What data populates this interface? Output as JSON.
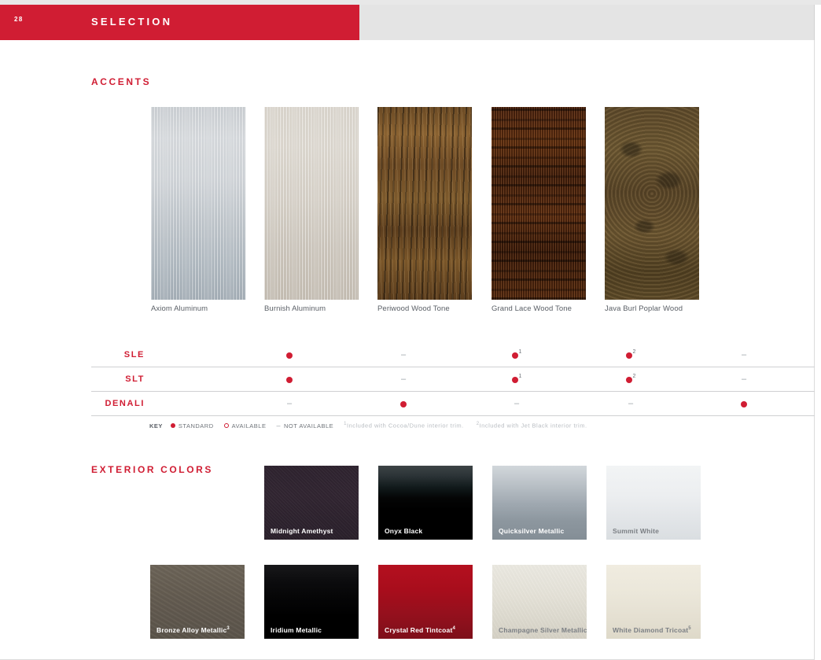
{
  "header": {
    "page_number": "28",
    "title": "SELECTION",
    "accent_color": "#d01d33"
  },
  "accents": {
    "title": "ACCENTS",
    "swatches": [
      {
        "label": "Axiom Aluminum",
        "texture": "tex-axiom"
      },
      {
        "label": "Burnish Aluminum",
        "texture": "tex-burnish"
      },
      {
        "label": "Periwood Wood Tone",
        "texture": "tex-periwood"
      },
      {
        "label": "Grand Lace Wood Tone",
        "texture": "tex-grandlace"
      },
      {
        "label": "Java Burl Poplar Wood",
        "texture": "tex-javaburl"
      }
    ],
    "table": {
      "rows": [
        {
          "name": "SLE",
          "cells": [
            "standard",
            "na",
            "standard1",
            "standard2",
            "na"
          ]
        },
        {
          "name": "SLT",
          "cells": [
            "standard",
            "na",
            "standard1",
            "standard2",
            "na"
          ]
        },
        {
          "name": "DENALI",
          "cells": [
            "na",
            "standard",
            "na",
            "na",
            "standard"
          ]
        }
      ]
    },
    "key": {
      "label": "KEY",
      "standard": "STANDARD",
      "available": "AVAILABLE",
      "not_available": "NOT AVAILABLE",
      "not_available_symbol": "–",
      "footnote_1": "Included with Cocoa/Dune interior trim.",
      "footnote_1_marker": "1",
      "footnote_2": "Included with Jet Black interior trim.",
      "footnote_2_marker": "2"
    }
  },
  "exterior": {
    "title": "EXTERIOR COLORS",
    "row1": [
      {
        "label": "Midnight Amethyst",
        "sup": "",
        "swatch": "c-midnight",
        "label_tone": "lbl-light"
      },
      {
        "label": "Onyx Black",
        "sup": "",
        "swatch": "c-onyx",
        "label_tone": "lbl-light"
      },
      {
        "label": "Quicksilver Metallic",
        "sup": "",
        "swatch": "c-quick",
        "label_tone": "lbl-light"
      },
      {
        "label": "Summit White",
        "sup": "",
        "swatch": "c-summit",
        "label_tone": "lbl-dark"
      }
    ],
    "row2": [
      {
        "label": "Bronze Alloy Metallic",
        "sup": "3",
        "swatch": "c-bronze",
        "label_tone": "lbl-light"
      },
      {
        "label": "Iridium Metallic",
        "sup": "",
        "swatch": "c-iridium",
        "label_tone": "lbl-light"
      },
      {
        "label": "Crystal Red Tintcoat",
        "sup": "4",
        "swatch": "c-crystal",
        "label_tone": "lbl-light"
      },
      {
        "label": "Champagne Silver Metallic",
        "sup": "",
        "swatch": "c-champagne",
        "label_tone": "lbl-dark"
      },
      {
        "label": "White Diamond Tricoat",
        "sup": "5",
        "swatch": "c-white-diamond",
        "label_tone": "lbl-dark"
      }
    ]
  }
}
